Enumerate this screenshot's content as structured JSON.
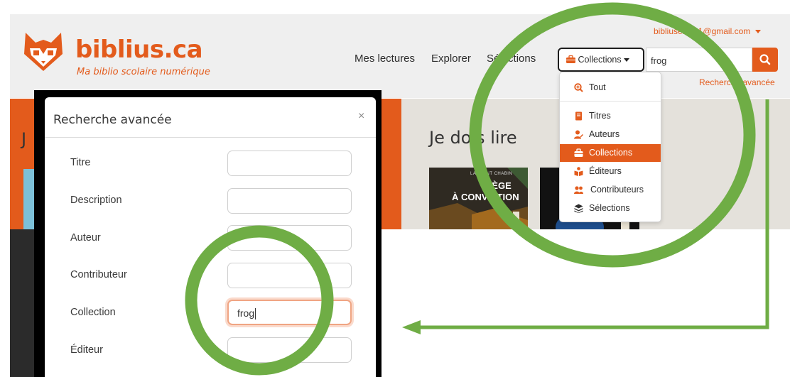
{
  "brand": {
    "name": "biblius.ca",
    "tagline": "Ma biblio scolaire numérique"
  },
  "nav": {
    "items": [
      "Mes lectures",
      "Explorer",
      "Sélections"
    ]
  },
  "user": {
    "email": "bibliuseleve1@gmail.com"
  },
  "search": {
    "scope_label": "Collections",
    "query": "frog",
    "advanced_link": "Recherche avancée"
  },
  "scope_menu": {
    "items": [
      {
        "label": "Tout",
        "icon": "search-plus-icon"
      },
      {
        "label": "Titres",
        "icon": "book-icon"
      },
      {
        "label": "Auteurs",
        "icon": "user-pen-icon"
      },
      {
        "label": "Collections",
        "icon": "briefcase-icon",
        "selected": true
      },
      {
        "label": "Éditeurs",
        "icon": "book-reader-icon"
      },
      {
        "label": "Contributeurs",
        "icon": "users-icon"
      },
      {
        "label": "Sélections",
        "icon": "layers-icon"
      }
    ]
  },
  "sections": {
    "left_title": "J",
    "right_title": "Je dois lire"
  },
  "books": [
    {
      "author": "LAURENT CHABIN",
      "title_line1": "PIÈGE",
      "title_line2": "À CONVICTION"
    }
  ],
  "advanced_modal": {
    "title": "Recherche avancée",
    "close": "×",
    "fields": [
      {
        "label": "Titre",
        "value": ""
      },
      {
        "label": "Description",
        "value": ""
      },
      {
        "label": "Auteur",
        "value": ""
      },
      {
        "label": "Contributeur",
        "value": ""
      },
      {
        "label": "Collection",
        "value": "frog"
      },
      {
        "label": "Éditeur",
        "value": ""
      }
    ]
  },
  "colors": {
    "brand_orange": "#e35b1c",
    "annotation_green": "#6fad45",
    "header_bg": "#efefef"
  }
}
